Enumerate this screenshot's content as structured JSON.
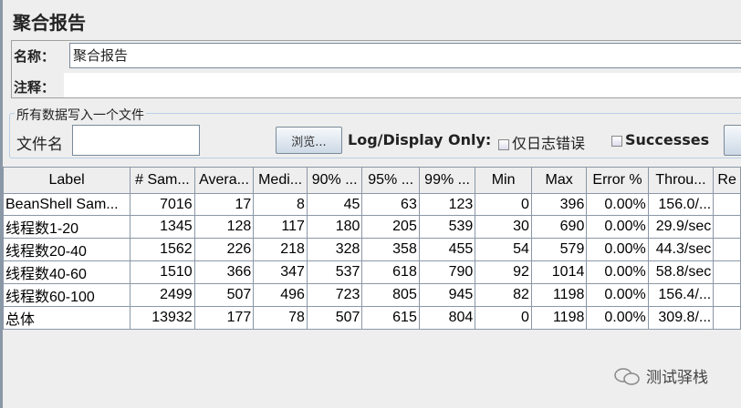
{
  "title": "聚合报告",
  "name_label": "名称：",
  "name_value": "聚合报告",
  "comment_label": "注释：",
  "comment_value": "",
  "file_group": {
    "legend": "所有数据写入一个文件",
    "file_label": "文件名",
    "file_value": "",
    "browse": "浏览...",
    "log_display": "Log/Display Only:",
    "errors_only": "仅日志错误",
    "successes": "Successes"
  },
  "table": {
    "headers": [
      "Label",
      "# Sam...",
      "Avera...",
      "Medi...",
      "90% ...",
      "95% ...",
      "99% ...",
      "Min",
      "Max",
      "Error %",
      "Throu...",
      "Re"
    ],
    "rows": [
      [
        "BeanShell Sam...",
        "7016",
        "17",
        "8",
        "45",
        "63",
        "123",
        "0",
        "396",
        "0.00%",
        "156.0/...",
        ""
      ],
      [
        "线程数1-20",
        "1345",
        "128",
        "117",
        "180",
        "205",
        "539",
        "30",
        "690",
        "0.00%",
        "29.9/sec",
        ""
      ],
      [
        "线程数20-40",
        "1562",
        "226",
        "218",
        "328",
        "358",
        "455",
        "54",
        "579",
        "0.00%",
        "44.3/sec",
        ""
      ],
      [
        "线程数40-60",
        "1510",
        "366",
        "347",
        "537",
        "618",
        "790",
        "92",
        "1014",
        "0.00%",
        "58.8/sec",
        ""
      ],
      [
        "线程数60-100",
        "2499",
        "507",
        "496",
        "723",
        "805",
        "945",
        "82",
        "1198",
        "0.00%",
        "156.4/...",
        ""
      ],
      [
        "总体",
        "13932",
        "177",
        "78",
        "507",
        "615",
        "804",
        "0",
        "1198",
        "0.00%",
        "309.8/...",
        ""
      ]
    ]
  },
  "watermark": "测试驿栈"
}
